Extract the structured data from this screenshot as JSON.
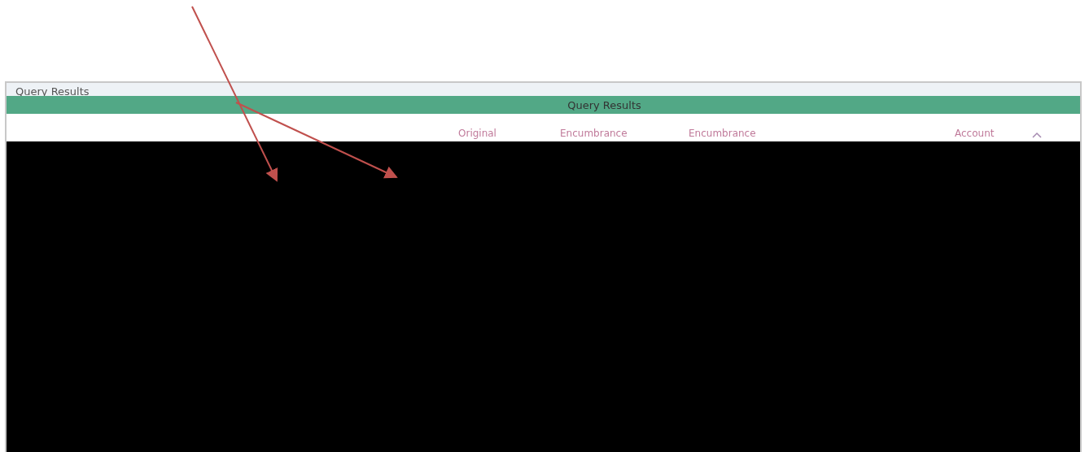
{
  "panel": {
    "title": "Query Results"
  },
  "banner": {
    "title": "Query Results"
  },
  "table": {
    "columns": [
      {
        "label": "Original",
        "kind": "text"
      },
      {
        "label": "Encumbrance",
        "kind": "text"
      },
      {
        "label": "Encumbrance",
        "kind": "text"
      },
      {
        "label": "Account",
        "kind": "sortable"
      }
    ]
  }
}
